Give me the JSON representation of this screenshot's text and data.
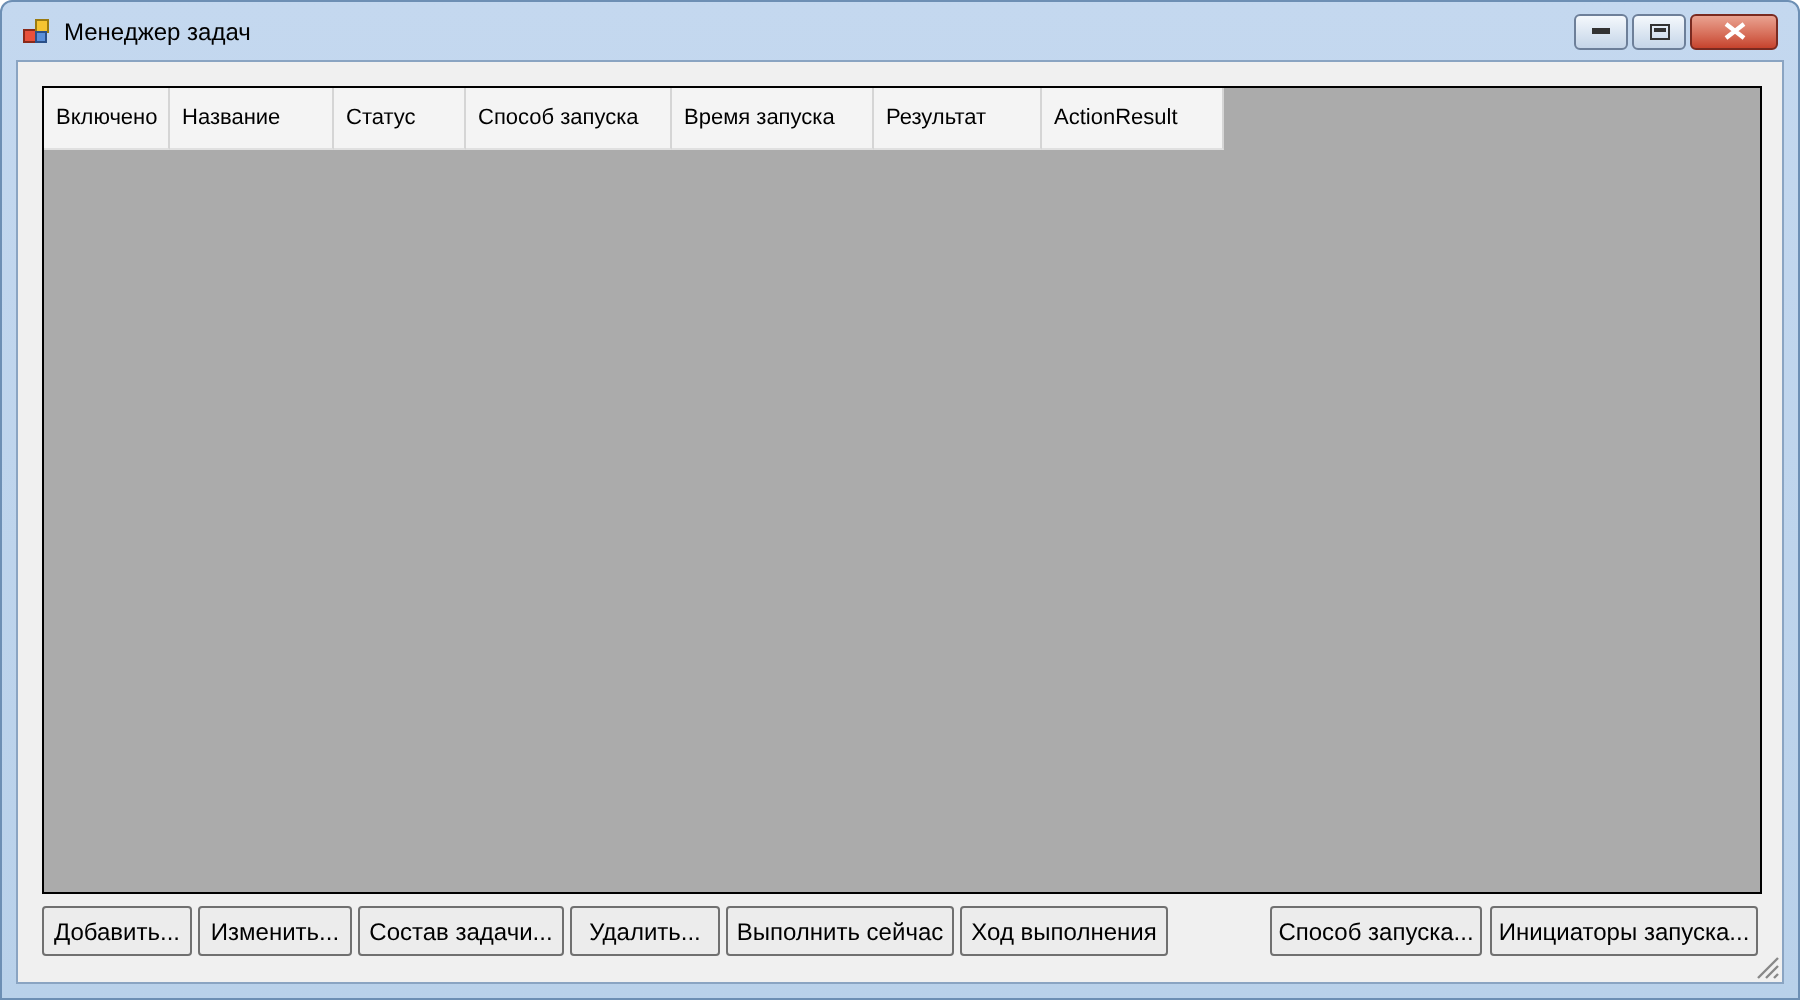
{
  "window": {
    "title": "Менеджер задач"
  },
  "table": {
    "columns": [
      "Включено",
      "Название",
      "Статус",
      "Способ запуска",
      "Время запуска",
      "Результат",
      "ActionResult"
    ]
  },
  "buttons_left": [
    "Добавить...",
    "Изменить...",
    "Состав задачи...",
    "Удалить...",
    "Выполнить сейчас",
    "Ход выполнения"
  ],
  "buttons_right": [
    "Способ запуска...",
    "Инициаторы запуска..."
  ]
}
